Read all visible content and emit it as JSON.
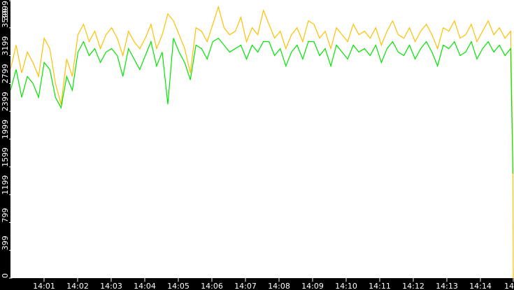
{
  "chart_data": {
    "type": "line",
    "title": "",
    "xlabel": "",
    "ylabel": "",
    "xlim_minutes_from_14_00": [
      0,
      15
    ],
    "ylim": [
      0,
      3999
    ],
    "y_ticks": [
      0,
      399,
      799,
      1199,
      1599,
      1999,
      2399,
      2799,
      3199,
      3599,
      3999
    ],
    "y_tick_labels": [
      "0",
      "399",
      "799",
      "1199",
      "1599",
      "1999",
      "2399",
      "2799",
      "3199",
      "3599",
      "3999"
    ],
    "x_ticks_minutes": [
      1,
      2,
      3,
      4,
      5,
      6,
      7,
      8,
      9,
      10,
      11,
      12,
      13,
      14,
      15
    ],
    "x_tick_labels": [
      "14:01",
      "14:02",
      "14:03",
      "14:04",
      "14:05",
      "14:06",
      "14:07",
      "14:08",
      "14:09",
      "14:10",
      "14:11",
      "14:12",
      "14:13",
      "14:14",
      "14"
    ],
    "grid": false,
    "legend": "none",
    "series": [
      {
        "name": "series-yellow",
        "color": "#ffc000",
        "values": [
          3000,
          3350,
          2950,
          3250,
          3100,
          2900,
          3450,
          3300,
          2800,
          2500,
          3150,
          2900,
          3500,
          3650,
          3400,
          3550,
          3300,
          3500,
          3600,
          3450,
          3200,
          3550,
          3400,
          3300,
          3450,
          3650,
          3300,
          3500,
          3800,
          3700,
          3500,
          3300,
          2950,
          3600,
          3550,
          3400,
          3650,
          3900,
          3600,
          3500,
          3550,
          3750,
          3400,
          3600,
          3500,
          3850,
          3650,
          3450,
          3550,
          3300,
          3500,
          3600,
          3400,
          3700,
          3650,
          3450,
          3550,
          3300,
          3600,
          3500,
          3400,
          3650,
          3500,
          3550,
          3450,
          3600,
          3350,
          3550,
          3700,
          3500,
          3450,
          3600,
          3400,
          3550,
          3650,
          3500,
          3300,
          3600,
          3550,
          3700,
          3450,
          3500,
          3650,
          3400,
          3550,
          3700,
          3500,
          3600,
          3450,
          3550
        ],
        "tail": [
          1600,
          0
        ]
      },
      {
        "name": "series-green",
        "color": "#00e600",
        "values": [
          2700,
          3000,
          2600,
          2900,
          2800,
          2600,
          3100,
          3000,
          2600,
          2450,
          2900,
          2700,
          3250,
          3400,
          3200,
          3300,
          3100,
          3250,
          3300,
          3200,
          2900,
          3300,
          3150,
          3000,
          3200,
          3400,
          3050,
          3250,
          2500,
          3450,
          3250,
          3100,
          2850,
          3350,
          3300,
          3150,
          3400,
          3450,
          3350,
          3250,
          3300,
          3350,
          3150,
          3350,
          3250,
          3400,
          3400,
          3200,
          3300,
          3050,
          3250,
          3350,
          3150,
          3400,
          3400,
          3200,
          3300,
          3050,
          3350,
          3250,
          3150,
          3350,
          3250,
          3300,
          3200,
          3350,
          3100,
          3300,
          3400,
          3250,
          3200,
          3350,
          3150,
          3300,
          3400,
          3250,
          3050,
          3350,
          3300,
          3400,
          3200,
          3250,
          3400,
          3150,
          3300,
          3400,
          3250,
          3350,
          3200,
          3300
        ],
        "tail": [
          1500
        ]
      }
    ]
  }
}
